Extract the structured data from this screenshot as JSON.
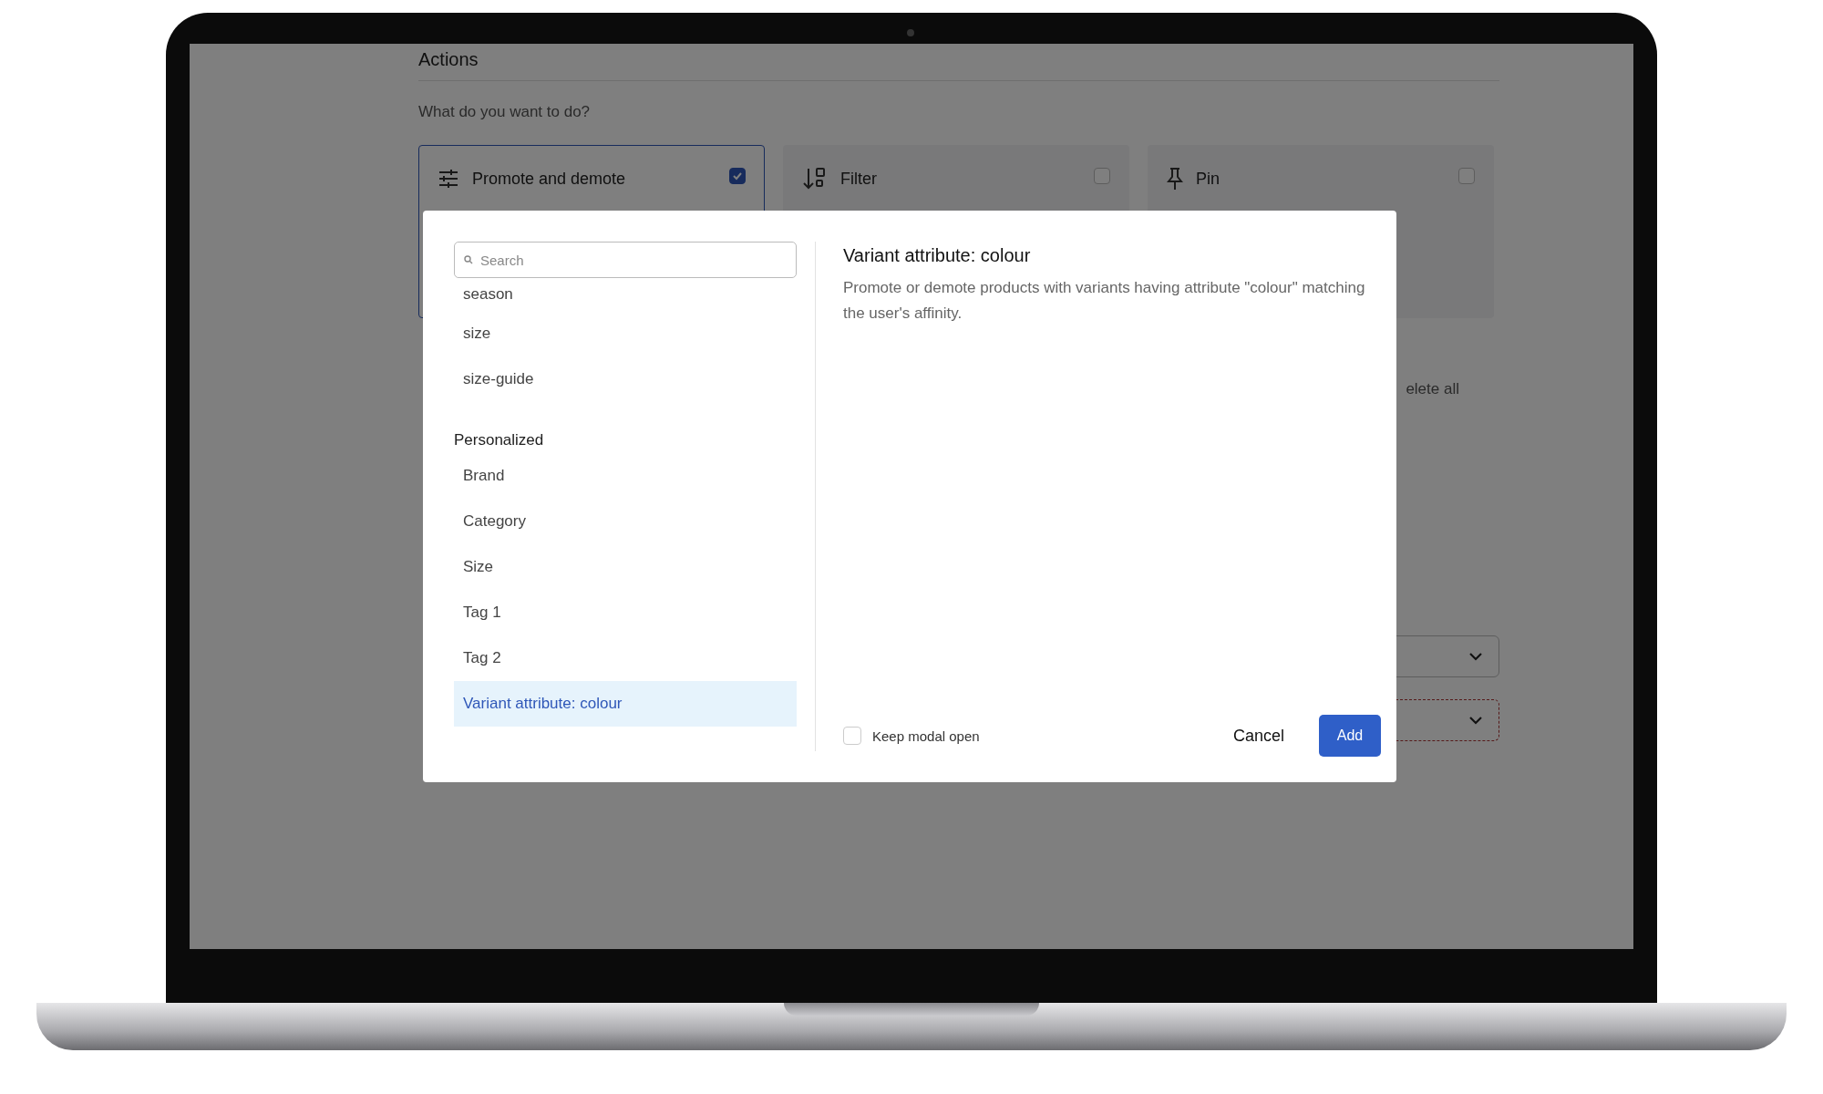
{
  "page": {
    "section_title": "Actions",
    "question": "What do you want to do?",
    "action_cards": [
      {
        "kind": "promote",
        "title": "Promote and demote",
        "selected": true,
        "checked": true
      },
      {
        "kind": "filter",
        "title": "Filter",
        "selected": false,
        "checked": false
      },
      {
        "kind": "pin",
        "title": "Pin",
        "selected": false,
        "checked": false
      }
    ],
    "delete_all": "elete all",
    "dropdowns": [
      {
        "invalid": false
      },
      {
        "invalid": true
      }
    ]
  },
  "modal": {
    "search": {
      "placeholder": "Search"
    },
    "groups": [
      {
        "items": [
          {
            "label": "season",
            "selected": false
          },
          {
            "label": "size",
            "selected": false
          },
          {
            "label": "size-guide",
            "selected": false
          }
        ]
      },
      {
        "heading": "Personalized",
        "items": [
          {
            "label": "Brand",
            "selected": false
          },
          {
            "label": "Category",
            "selected": false
          },
          {
            "label": "Size",
            "selected": false
          },
          {
            "label": "Tag 1",
            "selected": false
          },
          {
            "label": "Tag 2",
            "selected": false
          },
          {
            "label": "Variant attribute: colour",
            "selected": true
          }
        ]
      }
    ],
    "detail": {
      "title": "Variant attribute: colour",
      "description": "Promote or demote products with variants having attribute \"colour\" matching the user's affinity."
    },
    "keep_open": {
      "label": "Keep modal open",
      "checked": false
    },
    "buttons": [
      {
        "label": "Cancel",
        "kind": "text"
      },
      {
        "label": "Add",
        "kind": "primary"
      }
    ]
  }
}
